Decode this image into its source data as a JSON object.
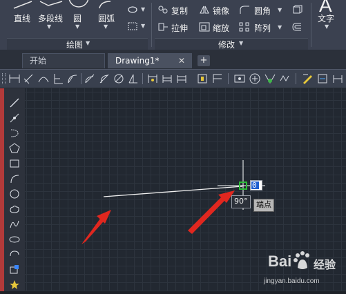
{
  "ribbon": {
    "draw_panel": {
      "tools": [
        {
          "label": "直线",
          "icon": "line-icon"
        },
        {
          "label": "多段线",
          "icon": "polyline-icon"
        },
        {
          "label": "圆",
          "icon": "circle-icon"
        },
        {
          "label": "圆弧",
          "icon": "arc-icon"
        }
      ],
      "title": "绘图"
    },
    "modify_panel": {
      "tools": [
        {
          "label": "复制",
          "icon": "copy-icon"
        },
        {
          "label": "镜像",
          "icon": "mirror-icon"
        },
        {
          "label": "圆角",
          "icon": "fillet-icon"
        },
        {
          "label": "拉伸",
          "icon": "stretch-icon"
        },
        {
          "label": "缩放",
          "icon": "scale-icon"
        },
        {
          "label": "阵列",
          "icon": "array-icon"
        }
      ],
      "title": "修改"
    },
    "text_tool": {
      "label": "文字",
      "icon_glyph": "A"
    }
  },
  "tabs": {
    "items": [
      {
        "label": "开始",
        "active": false
      },
      {
        "label": "Drawing1*",
        "active": true
      }
    ],
    "close_glyph": "✕",
    "add_glyph": "+"
  },
  "canvas": {
    "dynamic_input": {
      "value": "0"
    },
    "angle_tooltip": "90°",
    "snap_tooltip": "端点"
  },
  "watermark": {
    "brand": "Bai",
    "tail": "经验",
    "url": "jingyan.baidu.com"
  },
  "colors": {
    "ribbon_bg": "#3b4150",
    "canvas_bg": "#222831",
    "grid": "#2d343e",
    "arrow_red": "#e0271f",
    "snap_green": "#2dbb3a",
    "selection_blue": "#1f5fd0"
  }
}
